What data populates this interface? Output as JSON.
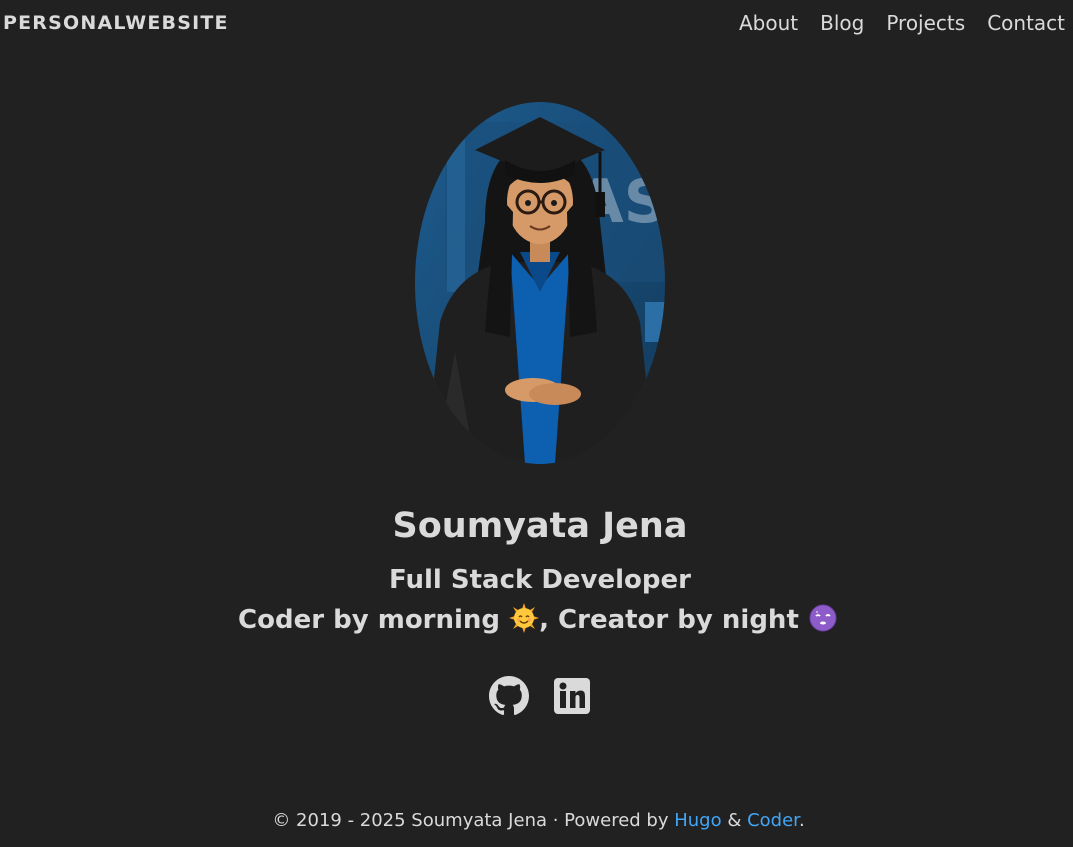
{
  "nav": {
    "brand": "PERSONALWEBSITE",
    "links": [
      {
        "label": "About"
      },
      {
        "label": "Blog"
      },
      {
        "label": "Projects"
      },
      {
        "label": "Contact"
      }
    ]
  },
  "profile": {
    "avatar_alt": "graduate-avatar",
    "name": "Soumyata Jena",
    "role": "Full Stack Developer",
    "tagline_part1": "Coder by morning",
    "tagline_emoji1": "sun-smiling-icon",
    "tagline_part2": ", Creator by night",
    "tagline_emoji2": "moon-sleepy-icon"
  },
  "socials": [
    {
      "icon": "github-icon"
    },
    {
      "icon": "linkedin-icon"
    }
  ],
  "footer": {
    "copyright": "© 2019 - 2025 Soumyata Jena · Powered by ",
    "hugo": "Hugo",
    "amp": " & ",
    "coder": "Coder",
    "period": "."
  },
  "colors": {
    "background": "#212121",
    "text": "#dadada",
    "link": "#42a5f5"
  }
}
